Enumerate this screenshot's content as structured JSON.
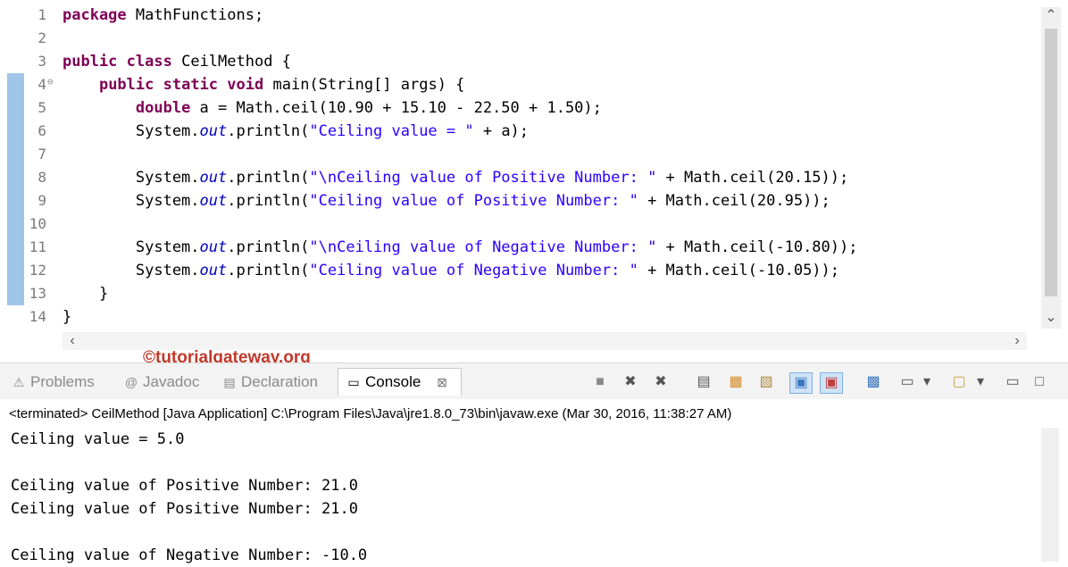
{
  "editor": {
    "lines": [
      {
        "num": "1",
        "fold": "",
        "parts": [
          {
            "t": "kw",
            "v": "package"
          },
          {
            "t": "plain",
            "v": " MathFunctions;"
          }
        ]
      },
      {
        "num": "2",
        "fold": "",
        "parts": []
      },
      {
        "num": "3",
        "fold": "",
        "parts": [
          {
            "t": "kw",
            "v": "public"
          },
          {
            "t": "plain",
            "v": " "
          },
          {
            "t": "kw",
            "v": "class"
          },
          {
            "t": "plain",
            "v": " CeilMethod {"
          }
        ]
      },
      {
        "num": "4",
        "fold": "⊖",
        "parts": [
          {
            "t": "plain",
            "v": "    "
          },
          {
            "t": "kw",
            "v": "public"
          },
          {
            "t": "plain",
            "v": " "
          },
          {
            "t": "kw",
            "v": "static"
          },
          {
            "t": "plain",
            "v": " "
          },
          {
            "t": "kw",
            "v": "void"
          },
          {
            "t": "plain",
            "v": " main(String[] args) {"
          }
        ]
      },
      {
        "num": "5",
        "fold": "",
        "parts": [
          {
            "t": "plain",
            "v": "        "
          },
          {
            "t": "kw",
            "v": "double"
          },
          {
            "t": "plain",
            "v": " a = Math.ceil(10.90 + 15.10 - 22.50 + 1.50);"
          }
        ]
      },
      {
        "num": "6",
        "fold": "",
        "parts": [
          {
            "t": "plain",
            "v": "        System."
          },
          {
            "t": "fld",
            "v": "out"
          },
          {
            "t": "plain",
            "v": ".println("
          },
          {
            "t": "str",
            "v": "\"Ceiling value = \""
          },
          {
            "t": "plain",
            "v": " + a);"
          }
        ]
      },
      {
        "num": "7",
        "fold": "",
        "parts": []
      },
      {
        "num": "8",
        "fold": "",
        "parts": [
          {
            "t": "plain",
            "v": "        System."
          },
          {
            "t": "fld",
            "v": "out"
          },
          {
            "t": "plain",
            "v": ".println("
          },
          {
            "t": "str",
            "v": "\"\\nCeiling value of Positive Number: \""
          },
          {
            "t": "plain",
            "v": " + Math.ceil(20.15));"
          }
        ]
      },
      {
        "num": "9",
        "fold": "",
        "parts": [
          {
            "t": "plain",
            "v": "        System."
          },
          {
            "t": "fld",
            "v": "out"
          },
          {
            "t": "plain",
            "v": ".println("
          },
          {
            "t": "str",
            "v": "\"Ceiling value of Positive Number: \""
          },
          {
            "t": "plain",
            "v": " + Math.ceil(20.95));"
          }
        ]
      },
      {
        "num": "10",
        "fold": "",
        "parts": []
      },
      {
        "num": "11",
        "fold": "",
        "parts": [
          {
            "t": "plain",
            "v": "        System."
          },
          {
            "t": "fld",
            "v": "out"
          },
          {
            "t": "plain",
            "v": ".println("
          },
          {
            "t": "str",
            "v": "\"\\nCeiling value of Negative Number: \""
          },
          {
            "t": "plain",
            "v": " + Math.ceil(-10.80));"
          }
        ]
      },
      {
        "num": "12",
        "fold": "",
        "parts": [
          {
            "t": "plain",
            "v": "        System."
          },
          {
            "t": "fld",
            "v": "out"
          },
          {
            "t": "plain",
            "v": ".println("
          },
          {
            "t": "str",
            "v": "\"Ceiling value of Negative Number: \""
          },
          {
            "t": "plain",
            "v": " + Math.ceil(-10.05));"
          }
        ]
      },
      {
        "num": "13",
        "fold": "",
        "parts": [
          {
            "t": "plain",
            "v": "    }"
          }
        ]
      },
      {
        "num": "14",
        "fold": "",
        "parts": [
          {
            "t": "plain",
            "v": "}"
          }
        ]
      }
    ]
  },
  "watermark": "©tutorialgateway.org",
  "tabs": {
    "problems": {
      "label": "Problems",
      "icon": "⚠"
    },
    "javadoc": {
      "label": "Javadoc",
      "icon": "@"
    },
    "declaration": {
      "label": "Declaration",
      "icon": "▤"
    },
    "console": {
      "label": "Console",
      "icon": "▭",
      "close": "⊠"
    }
  },
  "toolbar": {
    "terminate": "■",
    "remove": "✖",
    "remove_all": "✖",
    "scroll_lock": "▤",
    "word_wrap": "▦",
    "pin": "▧",
    "show_out": "▣",
    "show_err": "▣",
    "open_console": "▩",
    "display": "▭",
    "menu": "▾",
    "new": "▢",
    "minimize": "▭",
    "maximize": "□"
  },
  "status": "<terminated> CeilMethod [Java Application] C:\\Program Files\\Java\\jre1.8.0_73\\bin\\javaw.exe (Mar 30, 2016, 11:38:27 AM)",
  "console": {
    "lines": [
      "Ceiling value = 5.0",
      "",
      "Ceiling value of Positive Number: 21.0",
      "Ceiling value of Positive Number: 21.0",
      "",
      "Ceiling value of Negative Number: -10.0"
    ]
  }
}
